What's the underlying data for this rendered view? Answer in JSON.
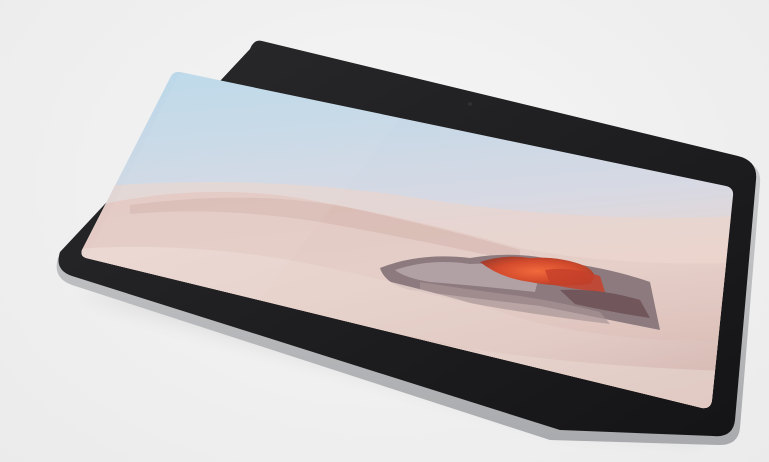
{
  "scene": {
    "subject": "tablet-with-kickstand",
    "colors": {
      "background": "#efefef",
      "bezel": "#1b1b1d",
      "chassis": "#c9cacc",
      "sky_top": "#b9d9ea",
      "sky_horizon": "#f1d3c8",
      "sand_light": "#e9d3cc",
      "sand_shadow": "#c4a59e",
      "rock_red": "#d24a2c",
      "rock_dark": "#6a4e52"
    }
  }
}
